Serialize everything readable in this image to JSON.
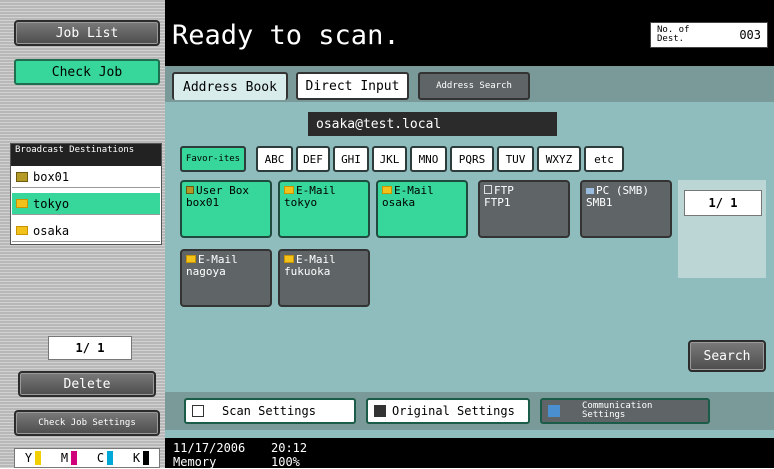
{
  "left_panel": {
    "job_list": "Job List",
    "check_job": "Check Job",
    "broadcast_title": "Broadcast Destinations",
    "broadcast_items": [
      {
        "icon": "user-box-icon",
        "label": "box01"
      },
      {
        "icon": "envelope-icon",
        "label": "tokyo"
      },
      {
        "icon": "envelope-icon",
        "label": "osaka"
      }
    ],
    "pager": "1/ 1",
    "delete": "Delete",
    "check_job_settings": "Check Job Settings",
    "toner": [
      "Y",
      "M",
      "C",
      "K"
    ]
  },
  "header": {
    "status": "Ready to scan.",
    "num_dest_label": "No. of Dest.",
    "num_dest_value": "003"
  },
  "tabs": [
    {
      "label": "Address Book"
    },
    {
      "label": "Direct Input"
    },
    {
      "label": "Address Search"
    }
  ],
  "destination_field": "osaka@test.local",
  "index_tabs": [
    "Favor-ites",
    "ABC",
    "DEF",
    "GHI",
    "JKL",
    "MNO",
    "PQRS",
    "TUV",
    "WXYZ",
    "etc"
  ],
  "tiles": [
    {
      "type": "User Box",
      "name": "box01",
      "selected": true,
      "icon": "user-box-icon"
    },
    {
      "type": "E-Mail",
      "name": "tokyo",
      "selected": true,
      "icon": "envelope-icon"
    },
    {
      "type": "E-Mail",
      "name": "osaka",
      "selected": true,
      "icon": "envelope-icon"
    },
    {
      "type": "FTP",
      "name": "FTP1",
      "selected": false,
      "icon": "ftp-icon"
    },
    {
      "type": "PC (SMB)",
      "name": "SMB1",
      "selected": false,
      "icon": "pc-icon"
    },
    {
      "type": "E-Mail",
      "name": "nagoya",
      "selected": false,
      "icon": "envelope-icon"
    },
    {
      "type": "E-Mail",
      "name": "fukuoka",
      "selected": false,
      "icon": "envelope-icon"
    }
  ],
  "page_indicator": "1/ 1",
  "search": "Search",
  "bottom": {
    "scan_settings": "Scan Settings",
    "original_settings": "Original Settings",
    "communication_settings": "Communication Settings"
  },
  "status_bar": {
    "date": "11/17/2006",
    "time": "20:12",
    "memory_label": "Memory",
    "memory_value": "100%"
  },
  "colors": {
    "accent_green": "#37d79b",
    "panel_teal": "#8fbcbc",
    "header_black": "#000000"
  }
}
